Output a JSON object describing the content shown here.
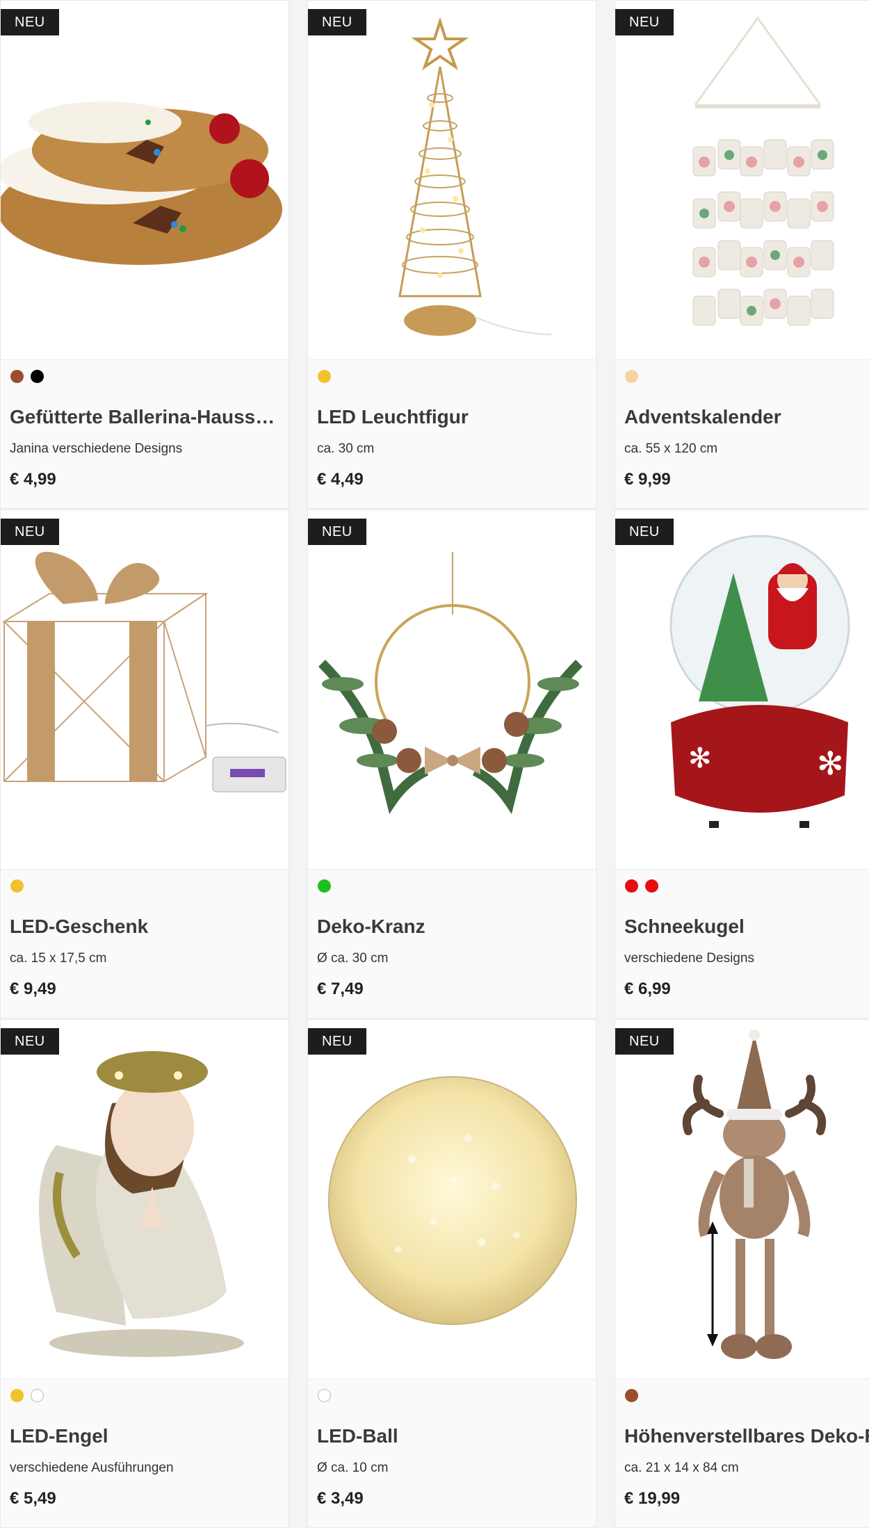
{
  "products": [
    {
      "badge": "NEU",
      "title": "Gefütterte Ballerina-Hausschuhe",
      "subtitle": "Janina verschiedene Designs",
      "price": "€ 4,99",
      "colors": [
        "#9a4f2a",
        "#000000"
      ],
      "image_icon": "slippers-icon"
    },
    {
      "badge": "NEU",
      "title": "LED Leuchtfigur",
      "subtitle": "ca. 30 cm",
      "price": "€ 4,49",
      "colors": [
        "#f2c12e"
      ],
      "image_icon": "led-tree-icon"
    },
    {
      "badge": "NEU",
      "title": "Adventskalender",
      "subtitle": "ca. 55 x 120 cm",
      "price": "€ 9,99",
      "colors": [
        "#f7d3a3"
      ],
      "image_icon": "advent-calendar-icon"
    },
    {
      "badge": "NEU",
      "title": "LED-Geschenk",
      "subtitle": "ca. 15 x 17,5 cm",
      "price": "€ 9,49",
      "colors": [
        "#f2c12e"
      ],
      "image_icon": "gift-box-icon"
    },
    {
      "badge": "NEU",
      "title": "Deko-Kranz",
      "subtitle": "Ø ca. 30 cm",
      "price": "€ 7,49",
      "colors": [
        "#1fbf1f"
      ],
      "image_icon": "wreath-icon"
    },
    {
      "badge": "NEU",
      "title": "Schneekugel",
      "subtitle": "verschiedene Designs",
      "price": "€ 6,99",
      "colors": [
        "#e50f0f",
        "#e50f0f"
      ],
      "image_icon": "snow-globe-icon"
    },
    {
      "badge": "NEU",
      "title": "LED-Engel",
      "subtitle": "verschiedene Ausführungen",
      "price": "€ 5,49",
      "colors": [
        "#f2c12e",
        "#ffffff"
      ],
      "image_icon": "angel-icon"
    },
    {
      "badge": "NEU",
      "title": "LED-Ball",
      "subtitle": "Ø ca. 10 cm",
      "price": "€ 3,49",
      "colors": [
        "#ffffff"
      ],
      "image_icon": "led-ball-icon"
    },
    {
      "badge": "NEU",
      "title": "Höhenverstellbares Deko-Rentier",
      "subtitle": "ca. 21 x 14 x 84 cm",
      "price": "€ 19,99",
      "colors": [
        "#9a4f2a"
      ],
      "image_icon": "reindeer-icon"
    }
  ]
}
